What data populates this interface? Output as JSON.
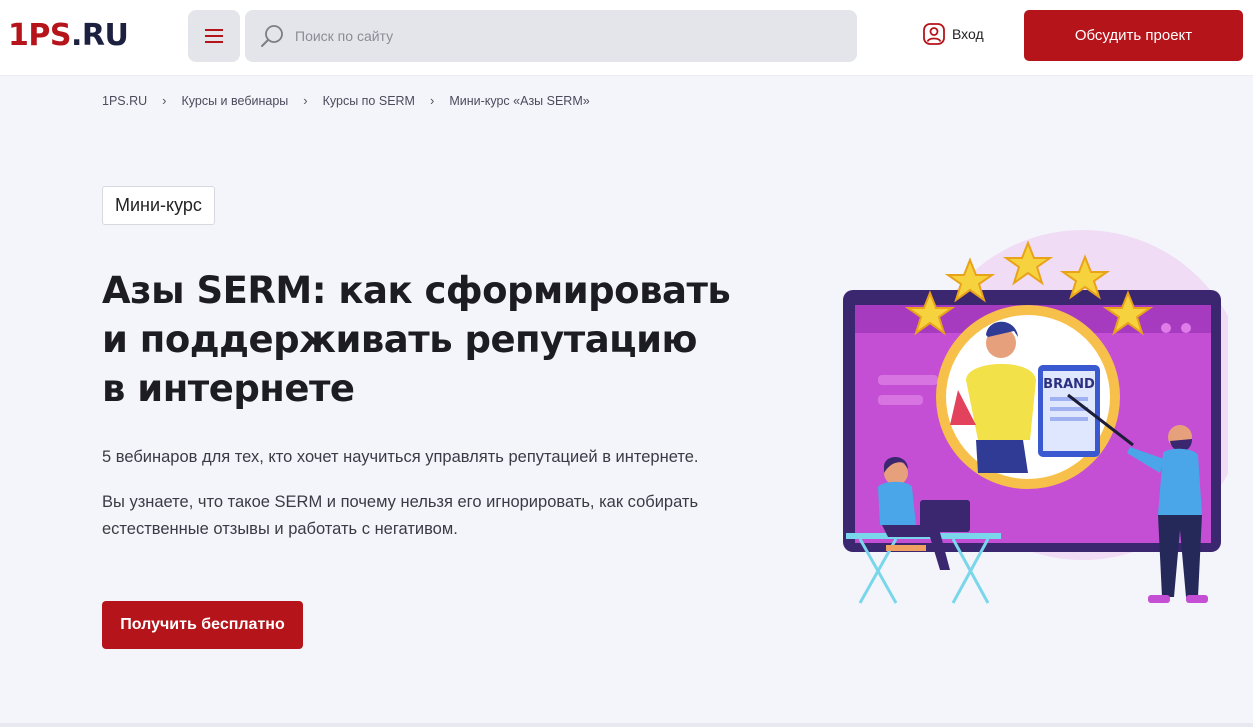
{
  "logo": {
    "part_a": "1PS",
    "part_b": ".RU"
  },
  "header": {
    "search_placeholder": "Поиск по сайту",
    "login_label": "Вход",
    "cta_label": "Обсудить проект"
  },
  "breadcrumb": [
    "1PS.RU",
    "Курсы и вебинары",
    "Курсы по SERM",
    "Мини-курс «Азы SERM»"
  ],
  "hero": {
    "tag": "Мини-курс",
    "title_lines": [
      "Азы SERM: как сформировать",
      "и поддерживать репутацию",
      "в интернете"
    ],
    "subtitle": "5 вебинаров для тех, кто хочет научиться управлять репутацией в интернете.",
    "description": "Вы узнаете, что такое SERM и почему нельзя его игнорировать, как собирать естественные отзывы и работать с негативом.",
    "cta_label": "Получить бесплатно"
  },
  "illustration": {
    "sign_text": "BRAND"
  },
  "colors": {
    "accent": "#b5141b",
    "logo_dark": "#1d2140",
    "background": "#f4f5fb"
  }
}
